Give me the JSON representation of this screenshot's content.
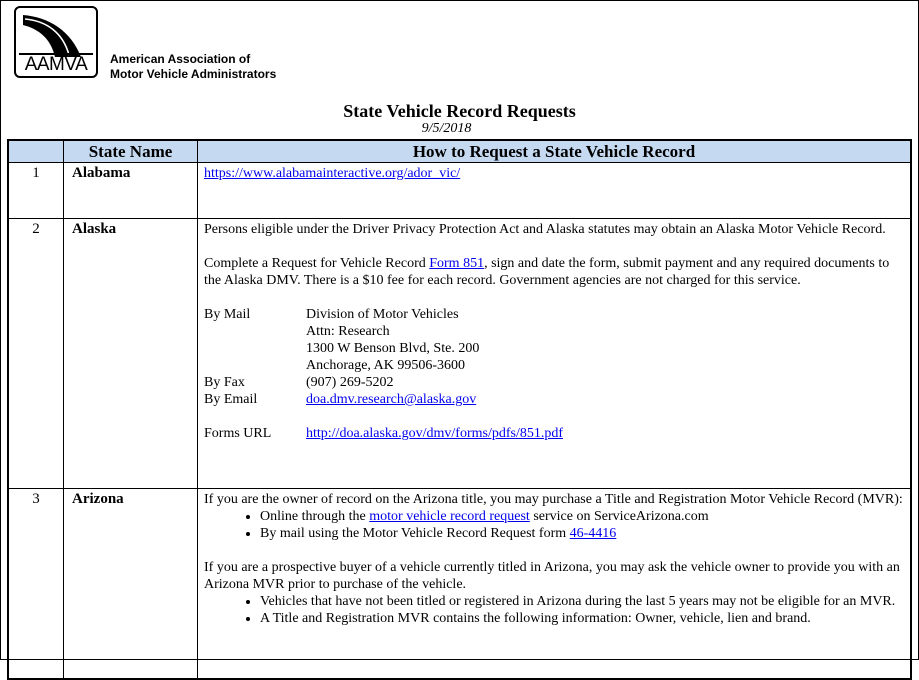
{
  "header": {
    "logo_text": "AAMVA",
    "org_line1": "American Association of",
    "org_line2": "Motor Vehicle Administrators",
    "title": "State Vehicle Record Requests",
    "date": "9/5/2018"
  },
  "table": {
    "columns": [
      "",
      "State Name",
      "How to Request a State Vehicle Record"
    ],
    "header_bg": "#c5d9f1",
    "rows": [
      {
        "num": "1",
        "state": "Alabama",
        "link": "https://www.alabamainteractive.org/ador_vic/"
      },
      {
        "num": "2",
        "state": "Alaska",
        "p1": "Persons eligible under the Driver Privacy Protection Act and Alaska statutes may obtain an Alaska Motor Vehicle Record.",
        "p2_pre": "Complete a Request for Vehicle Record ",
        "p2_link": "Form 851",
        "p2_post": ", sign and date the form, submit payment and any required documents to the Alaska DMV. There is a $10 fee for each record. Government agencies are not charged for this service.",
        "mail_label": "By Mail",
        "mail_lines": [
          "Division of Motor Vehicles",
          "Attn: Research",
          "1300 W Benson Blvd, Ste. 200",
          "Anchorage, AK 99506-3600"
        ],
        "fax_label": "By Fax",
        "fax": "(907) 269-5202",
        "email_label": "By Email",
        "email": "doa.dmv.research@alaska.gov",
        "forms_label": "Forms URL",
        "forms_url": "http://doa.alaska.gov/dmv/forms/pdfs/851.pdf"
      },
      {
        "num": "3",
        "state": "Arizona",
        "p1": "If you are the owner of record on the Arizona title, you may purchase a Title and Registration Motor Vehicle Record (MVR):",
        "b1_pre": "Online through the ",
        "b1_link": "motor vehicle record request",
        "b1_post": " service on ServiceArizona.com",
        "b2_pre": "By mail using the Motor Vehicle Record Request form ",
        "b2_link": "46-4416",
        "p2": "If you are a prospective buyer of a vehicle currently titled in Arizona, you may ask the vehicle owner to provide you with an Arizona MVR prior to purchase of the vehicle.",
        "b3": "Vehicles that have not been titled or registered in Arizona during the last 5 years may not be eligible for an MVR.",
        "b4": "A Title and Registration MVR contains the following information:  Owner, vehicle, lien and brand."
      }
    ]
  }
}
